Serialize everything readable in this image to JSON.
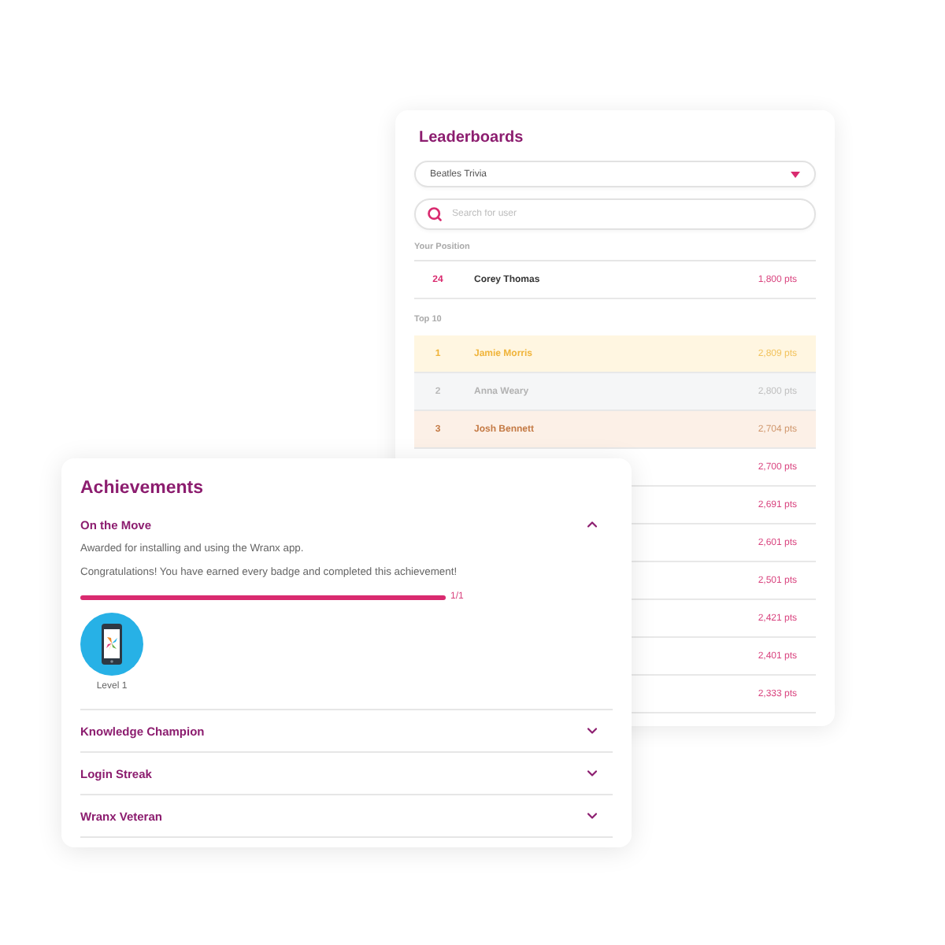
{
  "leaderboards": {
    "title": "Leaderboards",
    "quiz_select": {
      "value": "Beatles Trivia"
    },
    "search": {
      "placeholder": "Search for user"
    },
    "your_position": {
      "label": "Your Position",
      "row": {
        "rank": "24",
        "name": "Corey Thomas",
        "points": "1,800 pts"
      }
    },
    "top": {
      "label": "Top 10",
      "rows": [
        {
          "kind": "gold",
          "rank": "1",
          "name": "Jamie Morris",
          "points": "2,809 pts"
        },
        {
          "kind": "silver",
          "rank": "2",
          "name": "Anna Weary",
          "points": "2,800 pts"
        },
        {
          "kind": "bronze",
          "rank": "3",
          "name": "Josh Bennett",
          "points": "2,704 pts"
        },
        {
          "kind": "plain",
          "points": "2,700 pts"
        },
        {
          "kind": "plain",
          "points": "2,691 pts"
        },
        {
          "kind": "plain",
          "points": "2,601 pts"
        },
        {
          "kind": "plain",
          "points": "2,501 pts"
        },
        {
          "kind": "plain",
          "points": "2,421 pts"
        },
        {
          "kind": "plain",
          "points": "2,401 pts"
        },
        {
          "kind": "plain",
          "points": "2,333 pts"
        }
      ]
    }
  },
  "achievements": {
    "title": "Achievements",
    "items": [
      {
        "title": "On the Move",
        "expanded": true,
        "description": "Awarded for installing and using the Wranx app.",
        "message": "Congratulations! You have earned every badge and completed this achievement!",
        "progress": {
          "level": 1,
          "reading": "1/1"
        },
        "badges": [
          {
            "label": "Level 1"
          }
        ]
      },
      {
        "title": "Knowledge Champion",
        "expanded": false
      },
      {
        "title": "Login Streak",
        "expanded": false
      },
      {
        "title": "Wranx Veteran",
        "expanded": false
      }
    ]
  }
}
